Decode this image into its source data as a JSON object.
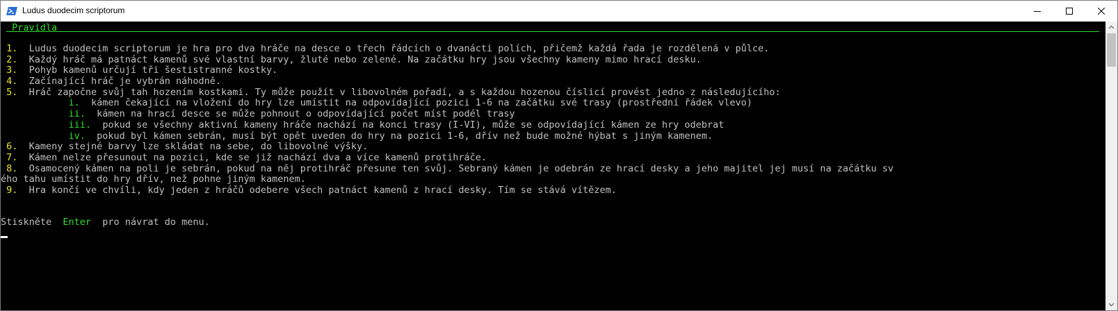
{
  "window": {
    "title": "Ludus duodecim scriptorum"
  },
  "console": {
    "header": " Pravidla",
    "lines": [
      {
        "num": " 1.  ",
        "text": "Ludus duodecim scriptorum je hra pro dva hráče na desce o třech řádcích o dvanácti polích, přičemž každá řada je rozdělená v půlce."
      },
      {
        "num": " 2.  ",
        "text": "Každý hráč má patnáct kamenů své vlastní barvy, žluté nebo zelené. Na začátku hry jsou všechny kameny mimo hrací desku."
      },
      {
        "num": " 3.  ",
        "text": "Pohyb kamenů určují tři šestistranné kostky."
      },
      {
        "num": " 4.  ",
        "text": "Začínající hráč je vybrán náhodně."
      },
      {
        "num": " 5.  ",
        "text": "Hráč započne svůj tah hozením kostkami. Ty může použít v libovolném pořadí, a s každou hozenou číslicí provést jedno z následujícího:"
      },
      {
        "num": "            i.  ",
        "text": "kámen čekající na vložení do hry lze umístit na odpovídající pozici 1-6 na začátku své trasy (prostřední řádek vlevo)",
        "sub": true
      },
      {
        "num": "            ii.  ",
        "text": "kámen na hrací desce se může pohnout o odpovídající počet míst podél trasy",
        "sub": true
      },
      {
        "num": "            iii.  ",
        "text": "pokud se všechny aktivní kameny hráče nachází na konci trasy (I-VI), může se odpovídající kámen ze hry odebrat",
        "sub": true
      },
      {
        "num": "            iv.  ",
        "text": "pokud byl kámen sebrán, musí být opět uveden do hry na pozici 1-6, dřív než bude možné hýbat s jiným kamenem.",
        "sub": true
      },
      {
        "num": " 6.  ",
        "text": "Kameny stejné barvy lze skládat na sebe, do libovolné výšky."
      },
      {
        "num": " 7.  ",
        "text": "Kámen nelze přesunout na pozici, kde se již nachází dva a více kamenů protihráče."
      },
      {
        "num": " 8.  ",
        "text": "Osamocený kámen na poli je sebrán, pokud na něj protihráč přesune ten svůj. Sebraný kámen je odebrán ze hrací desky a jeho majitel jej musí na začátku sv"
      },
      {
        "num": "",
        "text": "ého tahu umístit do hry dřív, než pohne jiným kamenem."
      },
      {
        "num": " 9.  ",
        "text": "Hra končí ve chvíli, kdy jeden z hráčů odebere všech patnáct kamenů z hrací desky. Tím se stává vítězem."
      }
    ],
    "prompt_before": "Stiskněte  ",
    "prompt_key": "Enter",
    "prompt_after": "  pro návrat do menu."
  },
  "icons": {
    "app": "powershell-icon",
    "minimize": "minimize-icon",
    "maximize": "maximize-icon",
    "close": "close-icon"
  },
  "colors": {
    "console_bg": "#000000",
    "console_text": "#c0c0c0",
    "number": "#e8e82a",
    "highlight": "#2ee02e"
  }
}
